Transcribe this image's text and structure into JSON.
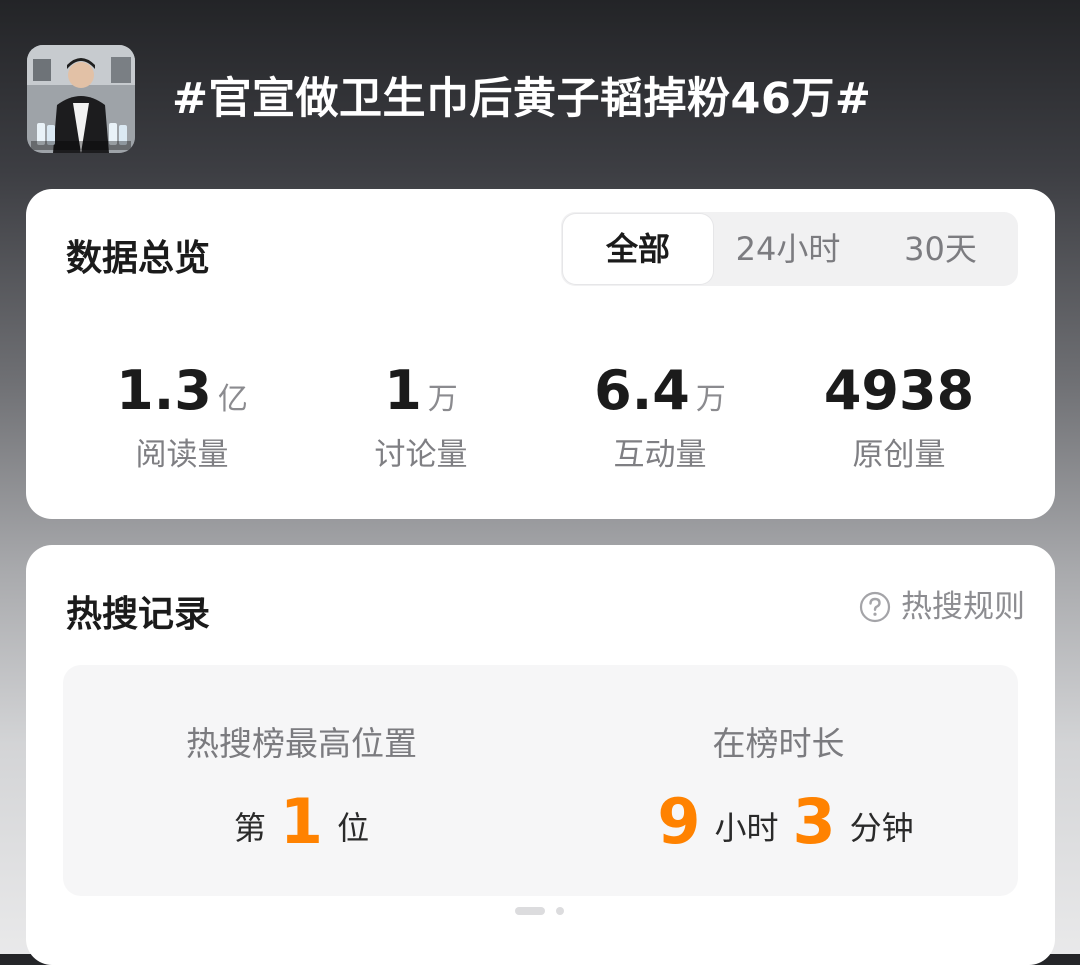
{
  "topic": {
    "title": "#官宣做卫生巾后黄子韬掉粉46万#",
    "thumbnail_caption": "#官宣做卫生巾后黄子韬掉粉46万#"
  },
  "overview": {
    "title": "数据总览",
    "tabs": [
      {
        "label": "全部",
        "active": true
      },
      {
        "label": "24小时",
        "active": false
      },
      {
        "label": "30天",
        "active": false
      }
    ],
    "stats": [
      {
        "value": "1.3",
        "unit": "亿",
        "label": "阅读量"
      },
      {
        "value": "1",
        "unit": "万",
        "label": "讨论量"
      },
      {
        "value": "6.4",
        "unit": "万",
        "label": "互动量"
      },
      {
        "value": "4938",
        "unit": "",
        "label": "原创量"
      }
    ]
  },
  "records": {
    "title": "热搜记录",
    "rules_link": "热搜规则",
    "highest_position": {
      "label": "热搜榜最高位置",
      "prefix": "第",
      "value": "1",
      "suffix": "位"
    },
    "duration": {
      "label": "在榜时长",
      "hours": "9",
      "hours_unit": "小时",
      "minutes": "3",
      "minutes_unit": "分钟"
    }
  },
  "colors": {
    "accent_orange": "#ff8200",
    "text_primary": "#1b1b1b",
    "text_secondary": "#7f7f83"
  },
  "icons": {
    "help": "question-circle-icon"
  }
}
